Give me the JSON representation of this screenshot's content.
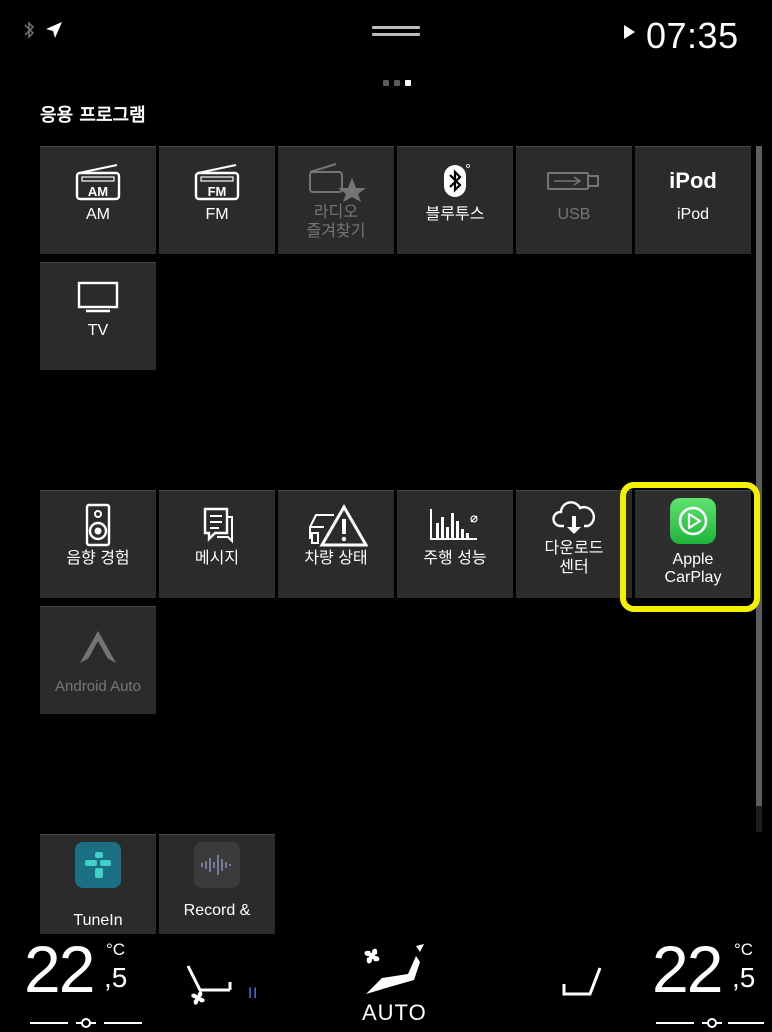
{
  "status": {
    "time": "07:35",
    "icons": [
      "bluetooth-icon",
      "navigation-arrow-icon",
      "play-icon"
    ]
  },
  "section_title": "응용 프로그램",
  "row1": [
    {
      "label": "AM",
      "icon": "am-radio-icon",
      "enabled": true
    },
    {
      "label": "FM",
      "icon": "fm-radio-icon",
      "enabled": true
    },
    {
      "label": "라디오\n즐겨찾기",
      "icon": "radio-favorites-icon",
      "enabled": false
    },
    {
      "label": "블루투스",
      "icon": "bluetooth-icon",
      "enabled": true
    },
    {
      "label": "USB",
      "icon": "usb-icon",
      "enabled": false
    },
    {
      "label": "iPod",
      "icon_text": "iPod",
      "enabled": true
    }
  ],
  "tv": {
    "label": "TV",
    "icon": "tv-icon"
  },
  "row2": [
    {
      "label": "음향 경험",
      "icon": "speaker-icon"
    },
    {
      "label": "메시지",
      "icon": "message-icon"
    },
    {
      "label": "차량 상태",
      "icon": "car-warning-icon"
    },
    {
      "label": "주행 성능",
      "icon": "driving-stats-icon"
    },
    {
      "label": "다운로드\n센터",
      "icon": "cloud-download-icon"
    },
    {
      "label": "Apple\nCarPlay",
      "icon": "carplay-icon",
      "highlighted": true
    }
  ],
  "android": {
    "label": "Android Auto",
    "enabled": false
  },
  "row3": [
    {
      "label": "TuneIn",
      "icon": "tunein-icon"
    },
    {
      "label": "Record &",
      "icon": "sound-wave-icon"
    }
  ],
  "climate": {
    "left_temp": "22",
    "left_decimal": ",5",
    "left_unit": "°C",
    "right_temp": "22",
    "right_decimal": ",5",
    "right_unit": "°C",
    "fan_level": "II",
    "mode": "AUTO"
  },
  "colors": {
    "highlight": "#f5f000",
    "carplay_green": "#2fc24a",
    "tile_bg": "#2b2b2b"
  }
}
